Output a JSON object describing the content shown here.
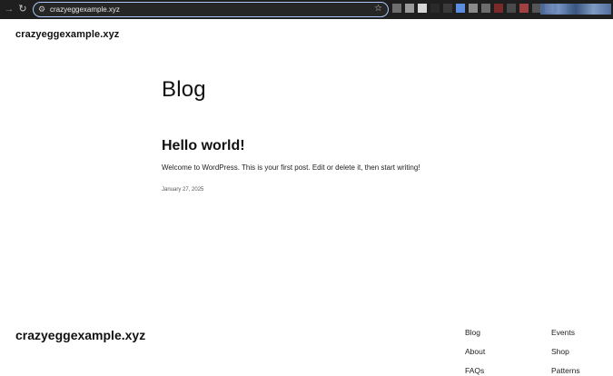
{
  "browser": {
    "url": "crazyeggexample.xyz",
    "extension_colors": [
      "#6e6e6e",
      "#9a9a9a",
      "#d6d6d6",
      "#2a2a2a",
      "#3a3a3a",
      "#5b8de0",
      "#8a8a8a",
      "#6d6d6d",
      "#7a2a2a",
      "#4a4a4a",
      "#a04040",
      "#555555",
      "#7c5c5c",
      "#3f3f3f"
    ]
  },
  "header": {
    "site_title": "crazyeggexample.xyz"
  },
  "main": {
    "heading": "Blog",
    "post": {
      "title": "Hello world!",
      "excerpt": "Welcome to WordPress. This is your first post. Edit or delete it, then start writing!",
      "date": "January 27, 2025"
    }
  },
  "footer": {
    "site_title": "crazyeggexample.xyz",
    "col1": [
      "Blog",
      "About",
      "FAQs"
    ],
    "col2": [
      "Events",
      "Shop",
      "Patterns"
    ]
  }
}
